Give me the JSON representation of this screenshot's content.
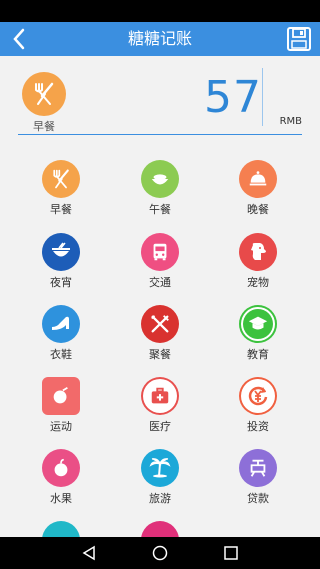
{
  "app_bar": {
    "title": "糖糖记账"
  },
  "entry": {
    "category": "早餐",
    "amount": "57",
    "currency": "RMB"
  },
  "categories": [
    {
      "label": "早餐",
      "icon": "fork-knife-icon",
      "color": "#f5a34a"
    },
    {
      "label": "午餐",
      "icon": "rice-bowl-icon",
      "color": "#8ccb52"
    },
    {
      "label": "晚餐",
      "icon": "serving-cloche-icon",
      "color": "#f57f50"
    },
    {
      "label": "夜宵",
      "icon": "noodle-bowl-icon",
      "color": "#1d5db8"
    },
    {
      "label": "交通",
      "icon": "bus-icon",
      "color": "#ef4f82"
    },
    {
      "label": "宠物",
      "icon": "dog-icon",
      "color": "#e84a4a"
    },
    {
      "label": "衣鞋",
      "icon": "high-heel-icon",
      "color": "#2e92dd"
    },
    {
      "label": "聚餐",
      "icon": "crossed-utensils-icon",
      "color": "#d9322f"
    },
    {
      "label": "教育",
      "icon": "graduation-cap-icon",
      "color": "#3cc23e"
    },
    {
      "label": "运动",
      "icon": "sport-ball-icon",
      "color": "#f26a6a"
    },
    {
      "label": "医疗",
      "icon": "medical-kit-icon",
      "color": "#e8504e"
    },
    {
      "label": "投资",
      "icon": "yuan-refresh-icon",
      "color": "#f06040"
    },
    {
      "label": "水果",
      "icon": "fruit-icon",
      "color": "#ea4f86"
    },
    {
      "label": "旅游",
      "icon": "palm-tree-icon",
      "color": "#1ca8d8"
    },
    {
      "label": "贷款",
      "icon": "loan-icon",
      "color": "#8d6fd8"
    }
  ],
  "partial_row_colors": [
    "#20b8c8",
    "#e0307a"
  ]
}
